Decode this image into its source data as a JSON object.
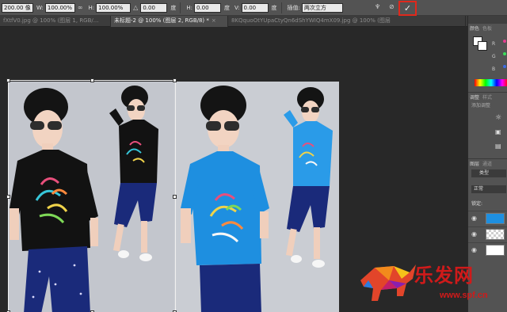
{
  "options_bar": {
    "w_value": "200.00 像",
    "w_label": "W:",
    "w_percent": "100.00%",
    "link_icon": "link-icon",
    "h_label": "H:",
    "h_percent": "100.00%",
    "angle_value": "0.00",
    "angle_unit": "度",
    "h_skew_label": "H:",
    "h_skew_value": "0.00",
    "h_skew_unit": "度",
    "v_skew_label": "V:",
    "v_skew_value": "0.00",
    "v_skew_unit": "度",
    "interp_label": "插值:",
    "interp_value": "两次立方"
  },
  "tabs": [
    {
      "label": "fXtfV0.jpg @ 100% (图层 1, RGB/...",
      "active": false
    },
    {
      "label": "未标题-2 @ 100% (图层 2, RGB/8) *",
      "active": true
    },
    {
      "label": "8KQquoOtYUpaCtyQn6dShYWIQ4mX09.jpg @ 100% (图层",
      "active": false
    }
  ],
  "panels": {
    "color_tab": "颜色",
    "swatches_tab": "色板",
    "adjust_tab": "调整",
    "styles_tab": "样式",
    "add_adjust": "添加调整",
    "layers_tab": "图层",
    "channels_tab": "通道",
    "kind_label": "类型",
    "blend_mode": "正常",
    "lock_label": "锁定:",
    "r_label": "R",
    "g_label": "G",
    "b_label": "B"
  },
  "watermark": {
    "text": "乐发网",
    "url": "www.spf.cn"
  },
  "colors": {
    "commit_highlight": "#e0281c",
    "shirt_black": "#111111",
    "shirt_blue": "#1e8fe0"
  }
}
